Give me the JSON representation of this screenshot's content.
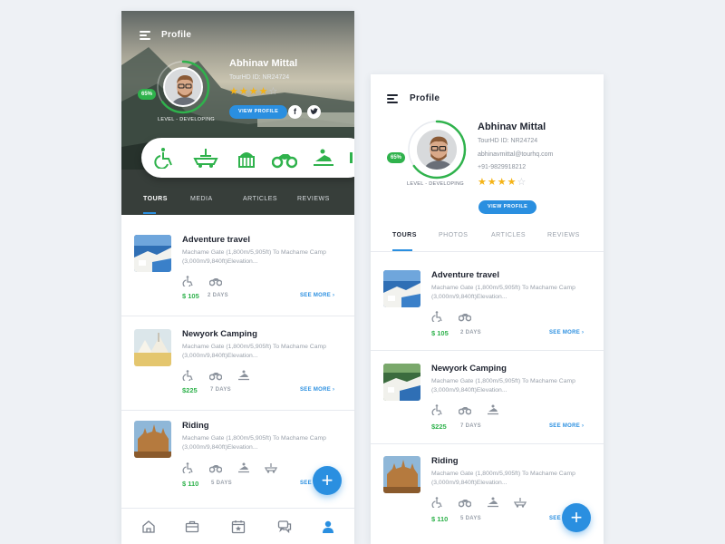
{
  "colors": {
    "accent": "#2a8fe0",
    "green": "#2fb24c",
    "star": "#f5b316",
    "page_bg": "#eef1f5"
  },
  "screen_title": "Profile",
  "profile": {
    "name": "Abhinav Mittal",
    "id_text": "TourHD ID: NR24724",
    "email": "abhinavmittal@tourhq.com",
    "phone": "+91-9829918212",
    "level_percent": "65%",
    "level_percent_value": 65,
    "level_label": "LEVEL - DEVELOPING",
    "rating": 4,
    "rating_max": 5,
    "view_profile": "VIEW PROFILE",
    "social": [
      "facebook-icon",
      "twitter-icon"
    ]
  },
  "left_activities": [
    "wheelchair-icon",
    "boat-icon",
    "cake-icon",
    "atv-icon",
    "snowmobile-icon"
  ],
  "left_tabs": [
    "TOURS",
    "MEDIA",
    "ARTICLES",
    "REVIEWS"
  ],
  "right_tabs": [
    "TOURS",
    "PHOTOS",
    "ARTICLES",
    "REVIEWS"
  ],
  "active_tab": 0,
  "tours": [
    {
      "title": "Adventure travel",
      "description": "Machame Gate (1,800m/5,905ft) To Machame Camp (3,000m/9,840ft)Elevation...",
      "price": "$ 105",
      "days": "2 DAYS",
      "see_more": "SEE MORE",
      "icons": [
        "wheelchair-icon",
        "atv-icon"
      ]
    },
    {
      "title": "Newyork Camping",
      "description": "Machame Gate (1,800m/5,905ft) To Machame Camp (3,000m/9,840ft)Elevation...",
      "price": "$225",
      "days": "7 DAYS",
      "see_more": "SEE MORE",
      "icons": [
        "wheelchair-icon",
        "atv-icon",
        "snowmobile-icon"
      ]
    },
    {
      "title": "Riding",
      "description": "Machame Gate (1,800m/5,905ft) To Machame Camp (3,000m/9,840ft)Elevation...",
      "price": "$ 110",
      "days": "5 DAYS",
      "see_more": "SEE MORE",
      "icons": [
        "wheelchair-icon",
        "atv-icon",
        "snowmobile-icon",
        "boat-icon"
      ]
    }
  ],
  "fab_label": "+",
  "bottom_nav": [
    "home-icon",
    "briefcase-icon",
    "calendar-star-icon",
    "chat-icon",
    "profile-icon"
  ],
  "bottom_nav_active": 4
}
